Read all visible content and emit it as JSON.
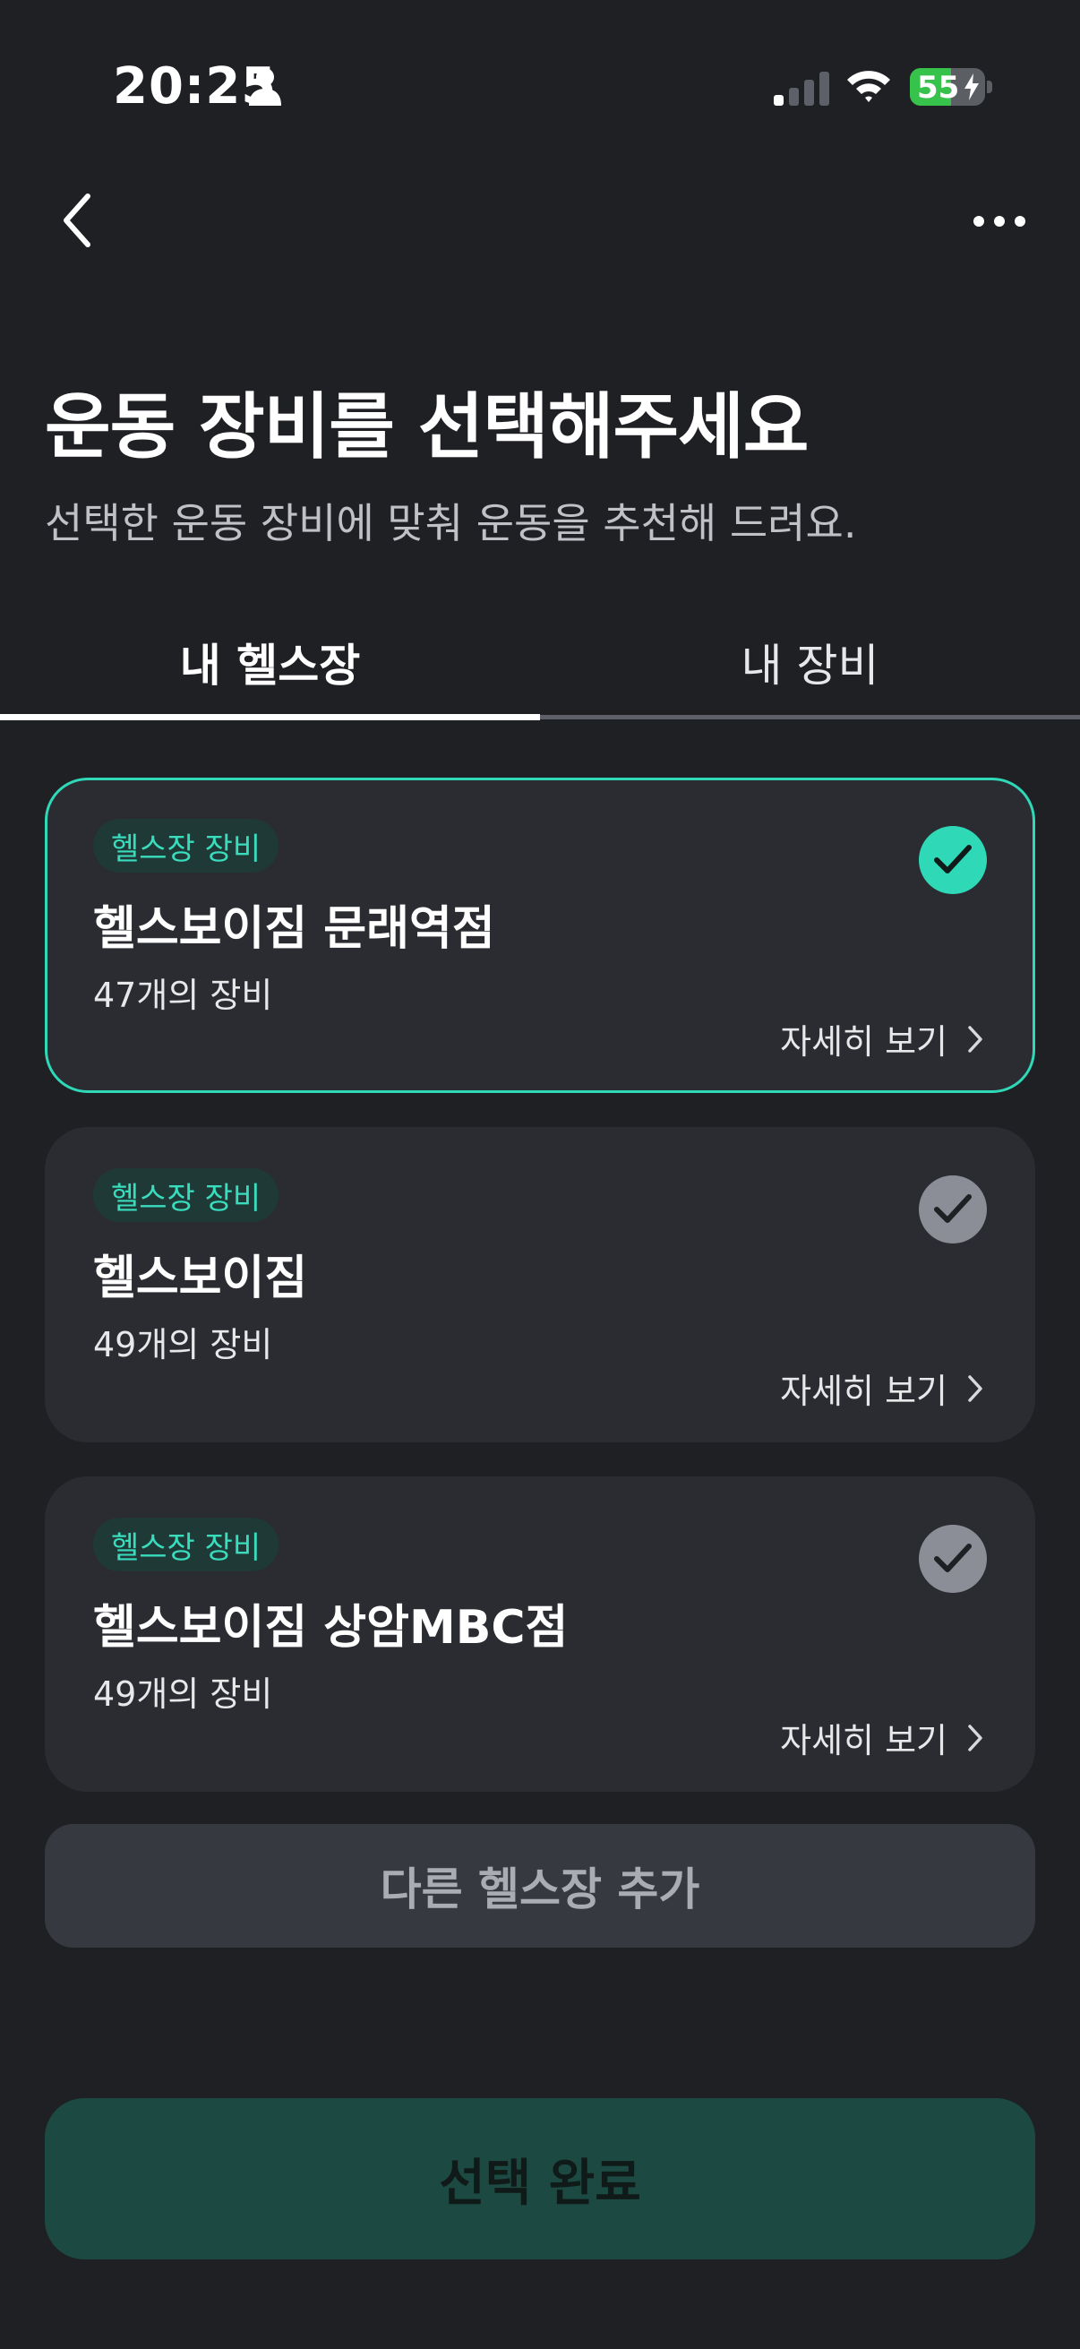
{
  "status_bar": {
    "time": "20:25",
    "battery": "55",
    "battery_level": 0.55
  },
  "header": {
    "back_icon": "chevron-left-icon",
    "more_icon": "more-horizontal-icon"
  },
  "page": {
    "title": "운동 장비를 선택해주세요",
    "subtitle": "선택한 운동 장비에 맞춰 운동을 추천해 드려요."
  },
  "tabs": [
    {
      "label": "내 헬스장",
      "active": true
    },
    {
      "label": "내 장비",
      "active": false
    }
  ],
  "gyms": [
    {
      "badge": "헬스장 장비",
      "name": "헬스보이짐 문래역점",
      "count": "47개의 장비",
      "detail": "자세히 보기",
      "selected": true
    },
    {
      "badge": "헬스장 장비",
      "name": "헬스보이짐",
      "count": "49개의 장비",
      "detail": "자세히 보기",
      "selected": false
    },
    {
      "badge": "헬스장 장비",
      "name": "헬스보이짐 상암MBC점",
      "count": "49개의 장비",
      "detail": "자세히 보기",
      "selected": false
    }
  ],
  "actions": {
    "add_gym": "다른 헬스장 추가",
    "confirm": "선택 완료"
  },
  "colors": {
    "background": "#1f2024",
    "card": "#2a2c31",
    "accent": "#2fd9b8",
    "check_inactive": "#8b8e96",
    "confirm_button": "#1c4a42",
    "battery_green": "#37c24c"
  }
}
